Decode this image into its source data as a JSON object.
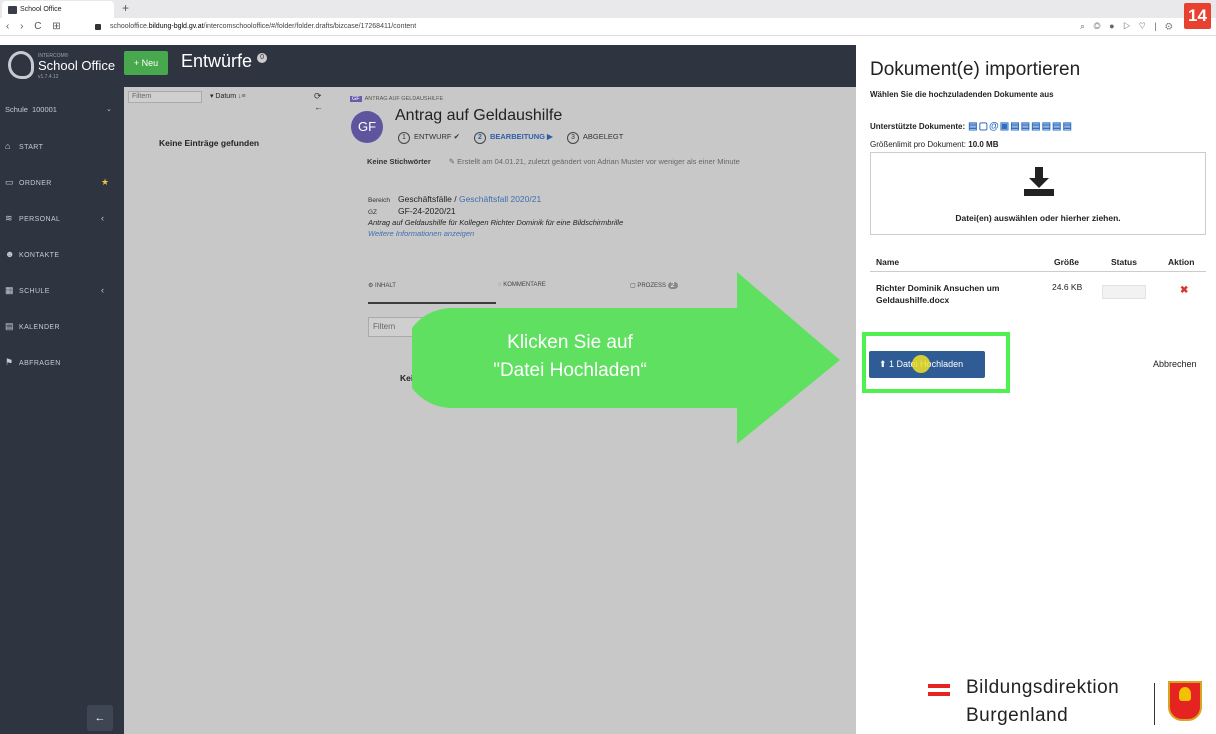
{
  "browser": {
    "tab_title": "School Office",
    "new_tab": "+",
    "nav": "‹ › C ⊞",
    "url_prefix": "schooloffice.",
    "url_domain": "bildung-bgld.gv.at",
    "url_path": "/intercomschooloffice/#/folder/folder.drafts/bizcase/17268411/content",
    "ext_icons": "⌕ ◎ ● ▷ ♡ | ⚙"
  },
  "step_number": "14",
  "sidebar": {
    "brand_sup": "INTERCOM®",
    "brand_name": "School Office",
    "brand_version": "v1.7.4.12",
    "school_label": "Schule",
    "school_number": "100001",
    "items": [
      {
        "icon": "⌂",
        "label": "Start"
      },
      {
        "icon": "▭",
        "label": "Ordner"
      },
      {
        "icon": "≋",
        "label": "Personal"
      },
      {
        "icon": "☻",
        "label": "Kontakte"
      },
      {
        "icon": "▦",
        "label": "Schule"
      },
      {
        "icon": "▤",
        "label": "Kalender"
      },
      {
        "icon": "⚑",
        "label": "Abfragen"
      }
    ],
    "collapse": "←"
  },
  "appbar": {
    "new_button": "+ Neu",
    "title": "Entwürfe",
    "count": "0"
  },
  "list": {
    "filter_placeholder": "Filtern",
    "sort_label": "▾ Datum",
    "sort_icon": "↓≡",
    "actions": "⟳ ←",
    "empty": "Keine Einträge gefunden"
  },
  "document": {
    "tag_badge": "GF",
    "tag": "Antrag auf Geldaushilfe",
    "avatar": "GF",
    "title": "Antrag auf Geldaushilfe",
    "steps": [
      {
        "num": "1",
        "label": "ENTWURF ✔"
      },
      {
        "num": "2",
        "label": "BEARBEITUNG ▶"
      },
      {
        "num": "3",
        "label": "ABGELEGT"
      }
    ],
    "keywords": "Keine Stichwörter",
    "created": "Erstellt am 04.01.21, zuletzt geändert von Adrian Muster vor weniger als einer Minute",
    "bereich_label": "Bereich",
    "bereich_value": "Geschäftsfälle /",
    "bereich_link": "Geschäftsfall 2020/21",
    "gz_label": "GZ",
    "gz_value": "GF-24-2020/21",
    "description": "Antrag auf Geldaushilfe für Kollegen Richter Dominik für eine Bildschirmbrille",
    "more_link": "Weitere Informationen anzeigen",
    "tabs": [
      "Inhalt",
      "Kommentare",
      "Prozess"
    ],
    "tab_badge": "2",
    "content_filter": "Filtern",
    "content_empty": "Kei"
  },
  "callout": {
    "line1": "Klicken Sie auf",
    "line2": "\"Datei Hochladen“"
  },
  "panel": {
    "title": "Dokument(e) importieren",
    "subtitle": "Wählen Sie die hochzuladenden Dokumente aus",
    "supported_label": "Unterstützte Dokumente:",
    "supported_icons": "▤▢@▣▤▤▤▤▤▤",
    "limit_label": "Größenlimit pro Dokument:",
    "limit_value": "10.0 MB",
    "dropzone_text": "Datei(en) auswählen oder hierher ziehen.",
    "columns": [
      "Name",
      "Größe",
      "Status",
      "Aktion"
    ],
    "file_name": "Richter Dominik Ansuchen um Geldaushilfe.docx",
    "file_size": "24.6 KB",
    "delete": "✖",
    "upload_button": "⬆ 1 Datei Hochladen",
    "cancel": "Abbrechen"
  },
  "footer_logo": {
    "line1": "Bildungsdirektion",
    "line2": "Burgenland"
  }
}
